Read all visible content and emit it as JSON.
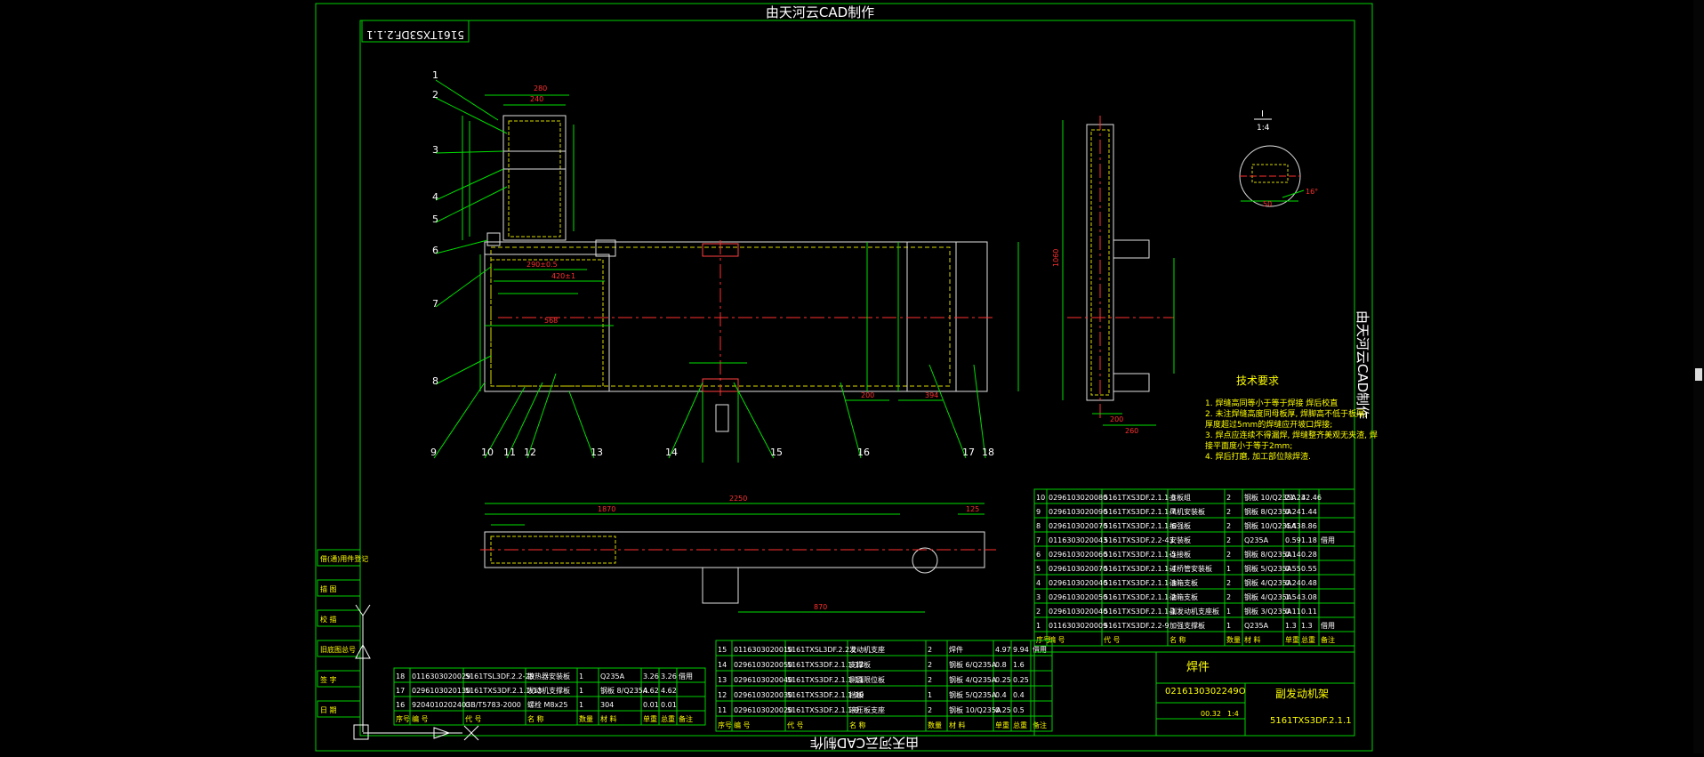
{
  "watermark": {
    "top": "由天河云CAD制作",
    "bottom": "由天河云CAD制作",
    "side": "由天河云CAD制作"
  },
  "drawing_code_mirrored": "5161TXS3DF.2.1.1",
  "tech_requirements": {
    "title": "技术要求",
    "items": [
      "1. 焊缝高同等小于等于焊接 焊后校直",
      "2. 未注焊缝高度同母板厚, 焊脚高不低于板厚;",
      "   厚度超过5mm的焊缝应开坡口焊接;",
      "3. 焊点应连续不得漏焊, 焊缝整齐美观无夹渣, 焊",
      "   接平面度小于等于2mm;",
      "4. 焊后打磨, 加工部位除焊渣."
    ]
  },
  "view_label": {
    "letter": "I",
    "scale": "1:4"
  },
  "balloons": [
    "1",
    "2",
    "3",
    "4",
    "5",
    "6",
    "7",
    "8",
    "9",
    "10",
    "11",
    "12",
    "13",
    "14",
    "15",
    "16",
    "17",
    "18"
  ],
  "dims": {
    "top_width": "280",
    "top_inner": "240",
    "overall_length": "2250",
    "left_len": "1870",
    "right_len": "125",
    "low_len": "870",
    "side_height": "1060",
    "width_568": "568",
    "width_420": "420±1",
    "width_290": "290±0.5",
    "d_200": "200",
    "d_394": "394",
    "side_200": "200",
    "side_260": "260",
    "detail_50": "50",
    "detail_16": "16°"
  },
  "bom_right": {
    "headers": [
      "序号",
      "编 号",
      "代 号",
      "名 称",
      "数量",
      "材 料",
      "单重",
      "总重",
      "备注"
    ],
    "rows": [
      [
        "10",
        "0296103020080",
        "5161TXS3DF.2.1.1-8",
        "立板组",
        "2",
        "钢板 10/Q235A",
        "21.23",
        "42.46",
        ""
      ],
      [
        "9",
        "0296103020090",
        "5161TXS3DF.2.1.1-7",
        "风机安装板",
        "2",
        "钢板 8/Q235A",
        "0.24",
        "1.44",
        ""
      ],
      [
        "8",
        "0296103020070",
        "5161TXS3DF.2.1.1-6",
        "加强板",
        "2",
        "钢板 10/Q235A",
        "4.43",
        "8.86",
        ""
      ],
      [
        "7",
        "0116303020043",
        "5161TXS3DF.2.2-43",
        "安装板",
        "2",
        "Q235A",
        "0.59",
        "1.18",
        "借用"
      ],
      [
        "6",
        "0296103020060",
        "5161TXS3DF.2.1.1-5",
        "连接板",
        "2",
        "钢板 8/Q235A",
        "0.14",
        "0.28",
        ""
      ],
      [
        "5",
        "0296103020070",
        "5161TXS3DF.2.1.1-4",
        "过桥管安装板",
        "1",
        "钢板 5/Q235A",
        "0.55",
        "0.55",
        ""
      ],
      [
        "4",
        "0296103020040",
        "5161TXS3DF.2.1.1-3",
        "油箱支板",
        "2",
        "钢板 4/Q235A",
        "0.24",
        "0.48",
        ""
      ],
      [
        "3",
        "0296103020050",
        "5161TXS3DF.2.1.1-2",
        "油箱支板",
        "2",
        "钢板 4/Q235A",
        "1.54",
        "3.08",
        ""
      ],
      [
        "2",
        "0296103020040",
        "5161TXS3DF.2.1.1-1",
        "副发动机支座板",
        "1",
        "钢板 3/Q235A",
        "0.11",
        "0.11",
        ""
      ],
      [
        "1",
        "0116303020009",
        "5161TXS3DF.2.2-9",
        "加强支撑板",
        "1",
        "Q235A",
        "1.3",
        "1.3",
        "借用"
      ]
    ]
  },
  "bom_mid": {
    "headers": [
      "序号",
      "编 号",
      "代 号",
      "名 称",
      "数量",
      "材 料",
      "单重",
      "总重",
      "备注"
    ],
    "rows": [
      [
        "15",
        "0116303020010",
        "5161TXSL3DF.2.2.2",
        "发动机支座",
        "2",
        "焊件",
        "4.97",
        "9.94",
        "借用"
      ],
      [
        "14",
        "0296103020050",
        "5161TXS3DF.2.1.1-12",
        "支撑板",
        "2",
        "钢板 6/Q235A",
        "0.8",
        "1.6",
        ""
      ],
      [
        "13",
        "0296103020040",
        "5161TXS3DF.2.1.1-11",
        "侧面限位板",
        "2",
        "钢板 4/Q235A",
        "0.25",
        "0.25",
        ""
      ],
      [
        "12",
        "0296103020030",
        "5161TXS3DF.2.1.1-10",
        "挡板",
        "1",
        "钢板 5/Q235A",
        "0.4",
        "0.4",
        ""
      ],
      [
        "11",
        "0296103020020",
        "5161TXS3DF.2.1.1-9",
        "液压板支座",
        "2",
        "钢板 10/Q235A",
        "0.25",
        "0.5",
        ""
      ]
    ]
  },
  "bom_left": {
    "headers": [
      "序号",
      "编 号",
      "代 号",
      "名 称",
      "数量",
      "材 料",
      "单重",
      "总重",
      "备注"
    ],
    "rows": [
      [
        "18",
        "0116303020029",
        "5161TSL3DF.2.2-29",
        "散热器安装板",
        "1",
        "Q235A",
        "3.26",
        "3.26",
        "借用"
      ],
      [
        "17",
        "0296103020130",
        "5161TXS3DF.2.1.1-13",
        "发动机支撑板",
        "1",
        "钢板 8/Q235A",
        "4.62",
        "4.62",
        ""
      ],
      [
        "16",
        "9204010202403",
        "GB/T5783-2000",
        "螺栓 M8x25",
        "1",
        "304",
        "0.01",
        "0.01",
        ""
      ]
    ]
  },
  "title_block": {
    "label": "焊件",
    "number": "0216130302249O",
    "name": "副发动机架",
    "code": "5161TXS3DF.2.1.1",
    "scale": "00.32",
    "sheet": "1:4"
  },
  "side_stamps": [
    "借(通)用件登记",
    "描 图",
    "校 描",
    "旧底图总号",
    "签 字",
    "日 期"
  ]
}
